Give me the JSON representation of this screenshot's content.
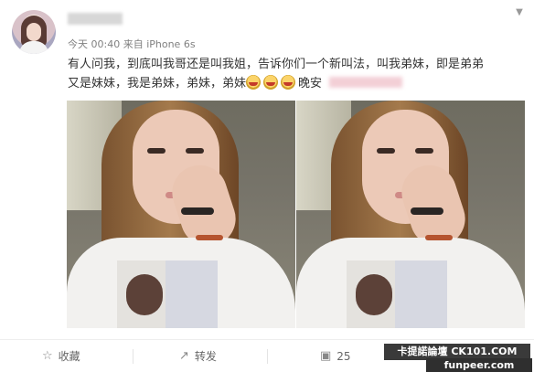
{
  "post": {
    "timestamp": "今天 00:40",
    "source": "来自 iPhone 6s",
    "text_lines": [
      "有人问我，到底叫我哥还是叫我姐，告诉你们一个新叫法，叫我弟妹，即是弟弟",
      "又是妹妹，我是弟妹，弟妹，弟妹"
    ],
    "signoff": "晚安"
  },
  "actions": {
    "favorite_label": "收藏",
    "repost_label": "转发",
    "comment_count": "25"
  },
  "watermark": {
    "line1": "卡提諾論壇 CK101.COM",
    "line2": "funpeer.com"
  },
  "icons": {
    "favorite": "star-icon",
    "repost": "repost-icon",
    "comment": "comment-icon",
    "menu": "chevron-down-icon"
  },
  "colors": {
    "meta_text": "#808080",
    "body_text": "#333333"
  }
}
